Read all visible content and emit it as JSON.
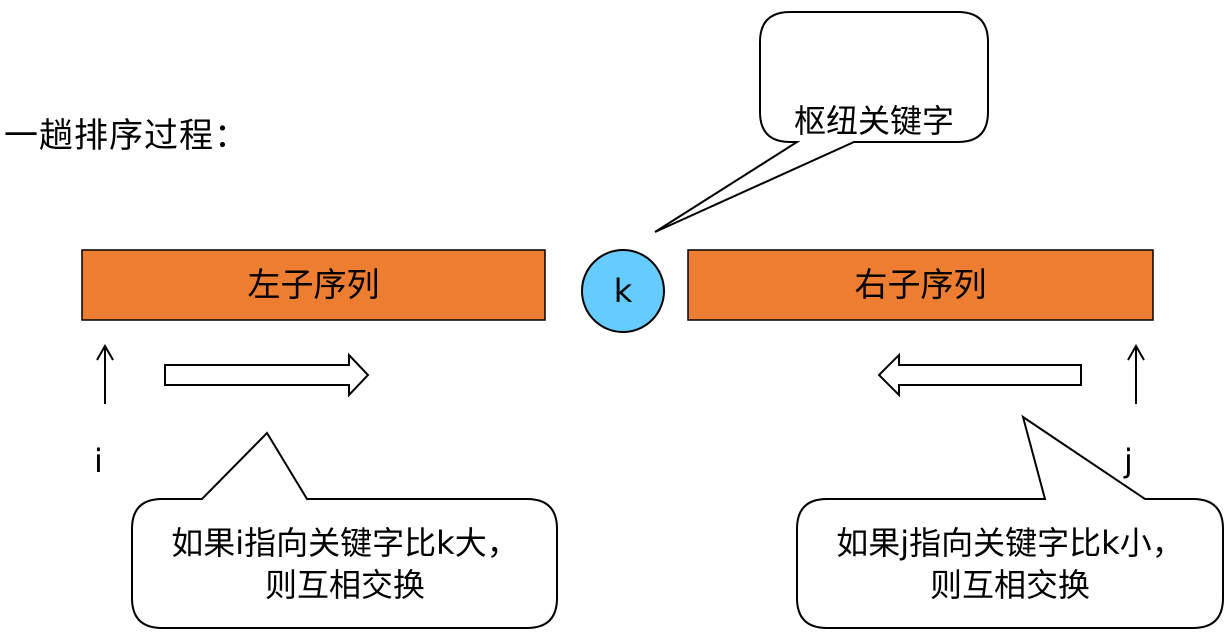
{
  "heading": "一趟排序过程：",
  "left_subsequence": "左子序列",
  "right_subsequence": "右子序列",
  "pivot_node": "k",
  "pivot_callout": "枢纽关键字",
  "pointer_i": "i",
  "pointer_j": "j",
  "callout_i": [
    "如果i指向关键字比k大，",
    "则互相交换"
  ],
  "callout_j": [
    "如果j指向关键字比k小，",
    "则互相交换"
  ],
  "colors": {
    "subsequence_fill": "#ED7D31",
    "pivot_fill": "#66CCFF",
    "stroke": "#000000"
  }
}
